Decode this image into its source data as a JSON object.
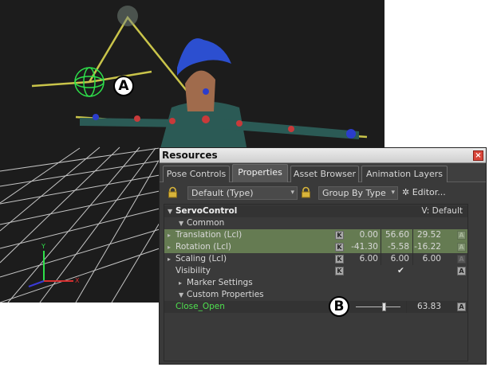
{
  "callouts": {
    "a": "A",
    "b": "B"
  },
  "viewport": {
    "axis_label_x": "X",
    "axis_label_y": "Y",
    "background_color": "#1c1c1c",
    "grid_color": "#d8d8d8",
    "skeleton_color": "#c9c44a",
    "marker_color": "#2ee04a"
  },
  "panel": {
    "title": "Resources",
    "close_icon": "close-icon",
    "close_glyph": "×",
    "tabs": [
      {
        "label": "Pose Controls",
        "active": false
      },
      {
        "label": "Properties",
        "active": true
      },
      {
        "label": "Asset Browser",
        "active": false
      },
      {
        "label": "Animation Layers",
        "active": false
      }
    ],
    "toolbar": {
      "lock_icon": "lock-icon",
      "default_dropdown": "Default (Type)",
      "group_dropdown": "Group By Type",
      "editor_label": "Editor...",
      "dropdown_arrow": "▾",
      "editor_glyph": "✲"
    },
    "properties": {
      "object_name": "ServoControl",
      "object_version": "V: Default",
      "common_header": "Common",
      "k_label": "K",
      "a_label": "A",
      "check_glyph": "✔",
      "rows": [
        {
          "label": "Translation (Lcl)",
          "values": [
            "0.00",
            "56.60",
            "29.52"
          ]
        },
        {
          "label": "Rotation (Lcl)",
          "values": [
            "-41.30",
            "-5.58",
            "-16.22"
          ]
        },
        {
          "label": "Scaling (Lcl)",
          "values": [
            "6.00",
            "6.00",
            "6.00"
          ]
        }
      ],
      "visibility_label": "Visibility",
      "marker_settings": "Marker Settings",
      "custom_properties": "Custom Properties",
      "close_open_label": "Close_Open",
      "close_open_value": "63.83",
      "close_open_slider": 0.62
    },
    "accent_green": "#657b52",
    "custom_label_color": "#4fe04f"
  }
}
